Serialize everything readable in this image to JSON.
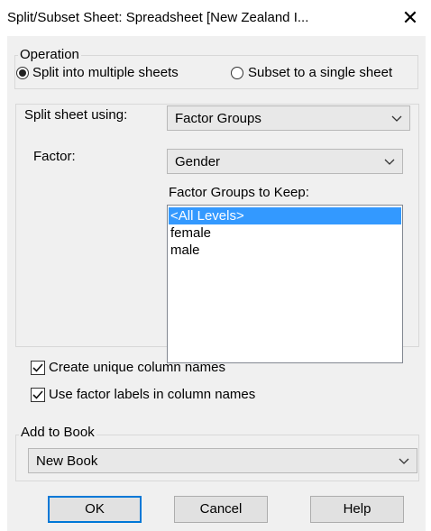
{
  "window": {
    "title": "Split/Subset Sheet: Spreadsheet [New Zealand I...",
    "close_glyph": "✕"
  },
  "operation": {
    "legend": "Operation",
    "options": [
      {
        "label": "Split into multiple sheets",
        "selected": true
      },
      {
        "label": "Subset to a single sheet",
        "selected": false
      }
    ]
  },
  "split": {
    "split_using_label": "Split sheet using:",
    "split_using_value": "Factor Groups",
    "factor_label": "Factor:",
    "factor_value": "Gender",
    "keep_label": "Factor Groups to Keep:",
    "keep_items": [
      {
        "label": "<All Levels>",
        "selected": true
      },
      {
        "label": "female",
        "selected": false
      },
      {
        "label": "male",
        "selected": false
      }
    ]
  },
  "options": {
    "unique_names": {
      "label": "Create unique column names",
      "checked": true
    },
    "factor_labels": {
      "label": "Use factor labels in column names",
      "checked": true
    }
  },
  "book": {
    "legend": "Add to Book",
    "value": "New Book"
  },
  "buttons": {
    "ok": "OK",
    "cancel": "Cancel",
    "help": "Help"
  },
  "colors": {
    "selection": "#3399ff",
    "default_button_border": "#0078d7",
    "dialog_bg": "#f0f0f0"
  },
  "icons": {
    "close": "close-icon",
    "dropdown": "chevron-down-icon",
    "check": "checkmark-icon"
  }
}
